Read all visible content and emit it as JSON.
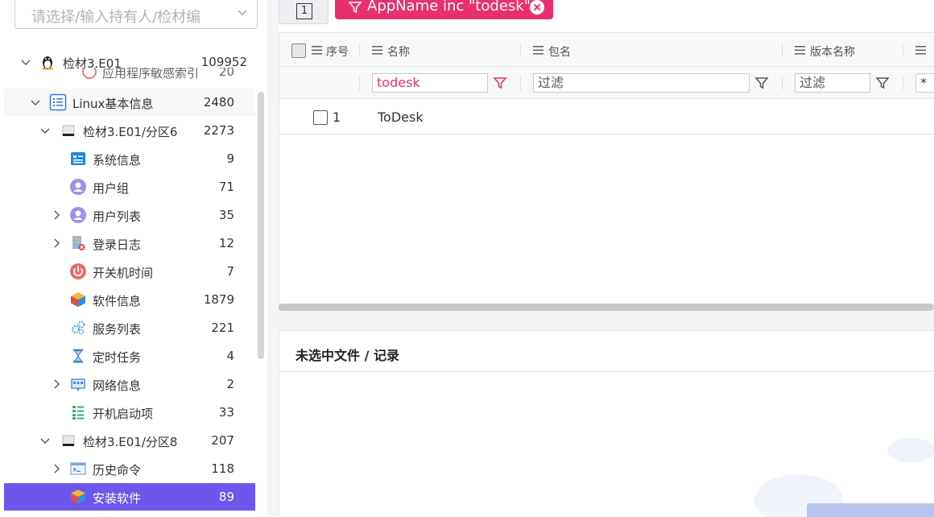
{
  "holder_select": {
    "placeholder": "请选择/输入持有人/检材编"
  },
  "tree": [
    {
      "label": "检材3.E01",
      "count": "109952",
      "icon": "linux-penguin-icon"
    },
    {
      "label": "应用程序敏感索引",
      "count": "20",
      "icon": "partial-hidden-icon"
    },
    {
      "label": "Linux基本信息",
      "count": "2480",
      "icon": "list-icon"
    },
    {
      "label": "检材3.E01/分区6",
      "count": "2273",
      "icon": "disk-icon"
    },
    {
      "label": "系统信息",
      "count": "9",
      "icon": "system-info-icon"
    },
    {
      "label": "用户组",
      "count": "71",
      "icon": "user-group-icon"
    },
    {
      "label": "用户列表",
      "count": "35",
      "icon": "user-icon"
    },
    {
      "label": "登录日志",
      "count": "12",
      "icon": "login-log-icon"
    },
    {
      "label": "开关机时间",
      "count": "7",
      "icon": "power-icon"
    },
    {
      "label": "软件信息",
      "count": "1879",
      "icon": "software-cube-icon"
    },
    {
      "label": "服务列表",
      "count": "221",
      "icon": "service-gear-icon"
    },
    {
      "label": "定时任务",
      "count": "4",
      "icon": "hourglass-icon"
    },
    {
      "label": "网络信息",
      "count": "2",
      "icon": "network-icon"
    },
    {
      "label": "开机启动项",
      "count": "33",
      "icon": "startup-icon"
    },
    {
      "label": "检材3.E01/分区8",
      "count": "207",
      "icon": "disk-icon"
    },
    {
      "label": "历史命令",
      "count": "118",
      "icon": "terminal-icon"
    },
    {
      "label": "安装软件",
      "count": "89",
      "icon": "software-cube-icon"
    }
  ],
  "toolbar": {
    "page_button": "1"
  },
  "filter_chip": {
    "text": "AppName inc \"todesk\""
  },
  "grid": {
    "columns": [
      "序号",
      "名称",
      "包名",
      "版本名称"
    ],
    "filters": {
      "name": "todesk",
      "package": "过滤",
      "version": "过滤",
      "next": "*"
    },
    "rows": [
      {
        "index": "1",
        "name": "ToDesk"
      }
    ]
  },
  "detail_panel": {
    "title": "未选中文件 / 记录"
  },
  "colors": {
    "accent": "#6d56ec",
    "chip": "#ea2f6f",
    "filter_active": "#e8336f"
  }
}
